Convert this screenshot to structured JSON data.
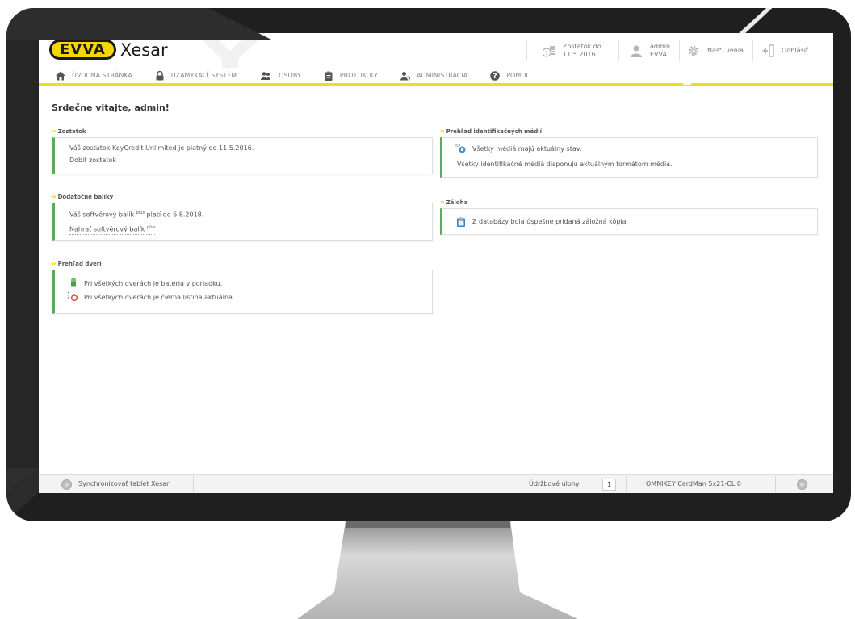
{
  "app": {
    "brand": "EVVA",
    "product": "Xesar"
  },
  "header": {
    "balance_line1": "Zostatok do",
    "balance_line2": "11.5.2016",
    "user_name": "admin",
    "user_org": "EVVA",
    "settings_label": "Nastavenia",
    "logout_label": "Odhlásiť"
  },
  "nav": [
    {
      "label": "ÚVODNÁ STRÁNKA",
      "icon": "home-icon"
    },
    {
      "label": "UZAMYKACÍ SYSTÉM",
      "icon": "lock-icon"
    },
    {
      "label": "OSOBY",
      "icon": "persons-icon"
    },
    {
      "label": "PROTOKOLY",
      "icon": "clipboard-icon"
    },
    {
      "label": "ADMINISTRÁCIA",
      "icon": "admin-icon"
    },
    {
      "label": "POMOC",
      "icon": "help-icon"
    }
  ],
  "page": {
    "title": "Srdečne vitajte, admin!"
  },
  "sections": {
    "balance": {
      "title": "Zostatok",
      "text": "Váš zostatok KeyCredit Unlimited je platný do 11.5.2016.",
      "link": "Dobiť zostatok"
    },
    "packages": {
      "title": "Dodatočné balíky",
      "text_before": "Váš softvérový balík",
      "text_sup": "plus",
      "text_after": "platí do 6.8.2018.",
      "link_before": "Nahrať softvérový balík",
      "link_sup": "plus"
    },
    "doors": {
      "title": "Prehľad dverí",
      "line1": "Pri všetkých dverách je batéria v poriadku.",
      "line2": "Pri všetkých dverách je čierna listina aktuálna."
    },
    "media": {
      "title": "Prehľad identifikačných médií",
      "line1": "Všetky médiá majú aktuálny stav.",
      "line2": "Všetky identifikačné médiá disponujú aktuálnym formátom média."
    },
    "backup": {
      "title": "Záloha",
      "line1": "Z databázy bola úspešne pridaná záložná kópia."
    }
  },
  "status_bar": {
    "sync_label": "Synchronizovať tablet Xesar",
    "tasks_label": "Údržbové úlohy",
    "tasks_count": "1",
    "reader": "OMNIKEY CardMan 5x21-CL 0"
  },
  "colors": {
    "accent_yellow": "#f3dc1f",
    "brand_yellow": "#f7d500",
    "panel_green": "#5daa5d",
    "bezel": "#1f1f20"
  }
}
